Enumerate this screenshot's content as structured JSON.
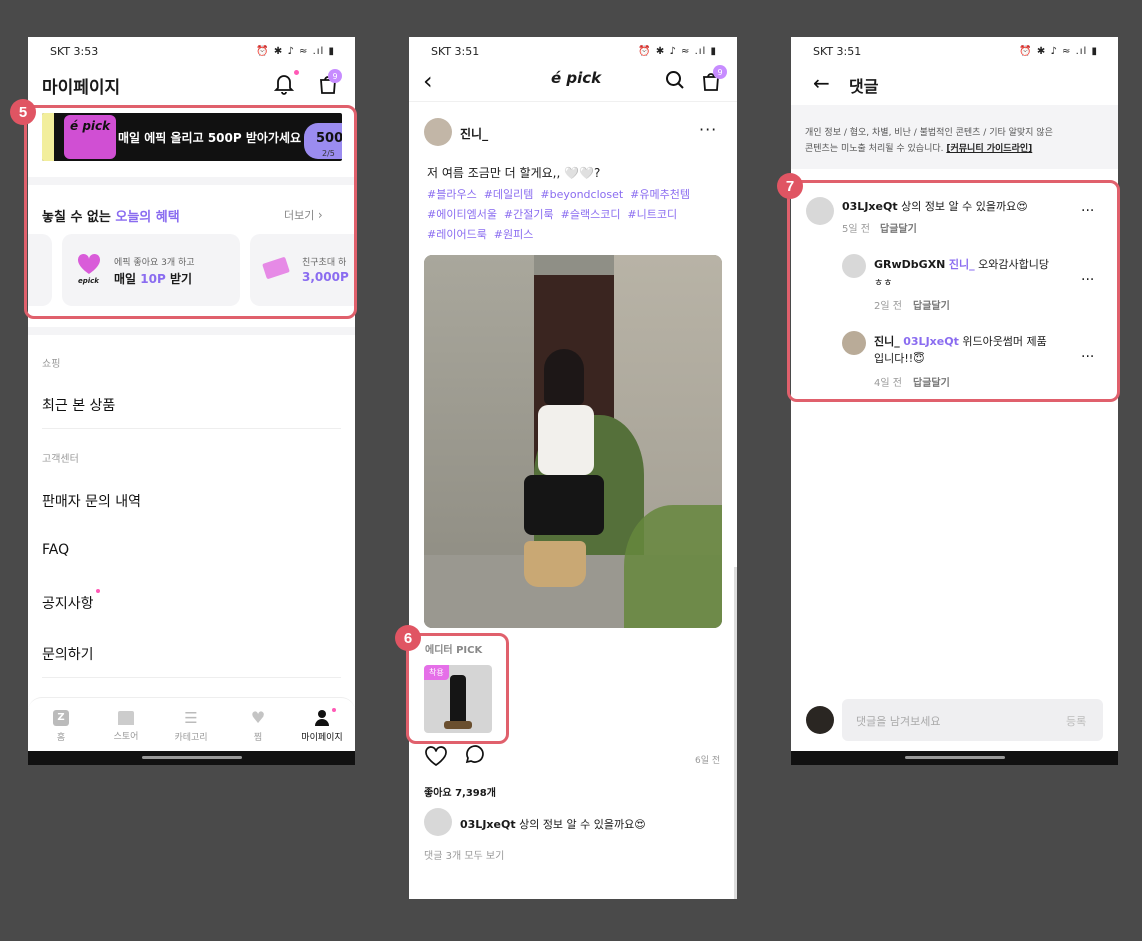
{
  "status": {
    "carrier_time_1": "SKT 3:53",
    "carrier_time_2": "SKT 3:51",
    "carrier_time_3": "SKT 3:51",
    "icons": "R",
    "right_icons": "⏰ ✱ ♪ ≈ .ıl ▮"
  },
  "callouts": {
    "c5": "5",
    "c6": "6",
    "c7": "7"
  },
  "screen1": {
    "title": "마이페이지",
    "cart_count": "9",
    "banner_logo": "é pick",
    "banner_text": "매일 에픽 올리고 500P 받아가세요",
    "banner_badge": "500",
    "banner_pager": "2/5",
    "benefit_title_a": "놓칠 수 없는 ",
    "benefit_title_b": "오늘의 혜택",
    "more_label": "더보기",
    "card1_sub": "에픽 좋아요 3개 하고",
    "card1_main_a": "매일 ",
    "card1_main_b": "10P",
    "card1_main_c": " 받기",
    "card1_logo": "epick",
    "card2_sub": "친구초대 하",
    "card2_main": "3,000P",
    "section_shopping": "쇼핑",
    "recent_products": "최근 본 상품",
    "section_cs": "고객센터",
    "seller_inquiry": "판매자 문의 내역",
    "faq": "FAQ",
    "notice": "공지사항",
    "contact": "문의하기",
    "tabs": [
      {
        "label": "홈"
      },
      {
        "label": "스토어"
      },
      {
        "label": "카테고리"
      },
      {
        "label": "찜"
      },
      {
        "label": "마이페이지"
      }
    ]
  },
  "screen2": {
    "logo": "é pick",
    "cart_count": "9",
    "username": "진니_",
    "caption": "저 여름 조금만 더 할게요,, 🤍🤍?",
    "tags_line1": "#블라우스  #데일리템  #beyondcloset  #유메추천템",
    "tags_line2": "#에이티엠서울  #간절기룩  #슬랙스코디  #니트코디",
    "tags_line3": "#레이어드룩  #원피스",
    "editor_pick": "에디터 PICK",
    "product_tag": "착용",
    "time": "6일 전",
    "likes": "좋아요 7,398개",
    "comment_user": "03LJxeQt",
    "comment_text": "상의 정보 알 수 있을까요😍",
    "view_all": "댓글 3개 모두 보기"
  },
  "screen3": {
    "title": "댓글",
    "notice_a": "개인 정보 / 혐오, 차별, 비난 / 불법적인 콘텐츠 / 기타 알맞지 않은",
    "notice_b": "콘텐츠는 미노출 처리될 수 있습니다. ",
    "notice_link": "[커뮤니티 가이드라인]",
    "comments": [
      {
        "user": "03LJxeQt",
        "mention": "",
        "text": "상의 정보 알 수 있을까요😍",
        "text2": "",
        "time": "5일 전",
        "reply": "답글달기"
      },
      {
        "user": "GRwDbGXN",
        "mention": "진니_",
        "text": "오와감사합니당",
        "text2": "ㅎㅎ",
        "time": "2일 전",
        "reply": "답글달기"
      },
      {
        "user": "진니_",
        "mention": "03LJxeQt",
        "text": "위드아웃썸머 제품",
        "text2": "입니다!!😇",
        "time": "4일 전",
        "reply": "답글달기"
      }
    ],
    "input_placeholder": "댓글을 남겨보세요",
    "submit": "등록"
  }
}
